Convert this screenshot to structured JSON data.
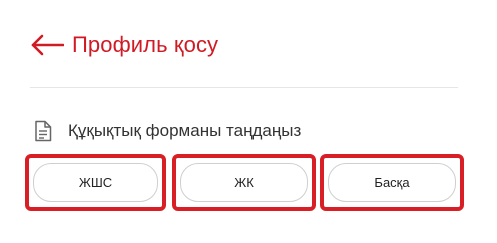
{
  "header": {
    "back_icon": "arrow-left-icon",
    "title": "Профиль қосу",
    "accent_color": "#d01a24"
  },
  "section": {
    "icon": "document-icon",
    "label": "Құқықтық форманы таңдаңыз"
  },
  "options": [
    {
      "label": "ЖШС"
    },
    {
      "label": "ЖК"
    },
    {
      "label": "Басқа"
    }
  ],
  "highlight_color": "#d81f26"
}
